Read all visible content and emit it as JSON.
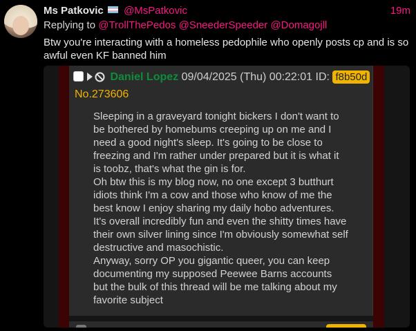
{
  "tweet": {
    "display_name": "Ms Patkovic",
    "flag_icon": "transgender-flag-icon",
    "handle": "@MsPatkovic",
    "time": "19m",
    "replying_prefix": "Replying to",
    "mentions": [
      "@TrollThePedos",
      "@SneederSpeeder",
      "@Domagojll"
    ],
    "text": "Btw you're interacting with a homeless pedophile who openly posts cp and is so awful even KF banned him"
  },
  "screenshot": {
    "poster_name": "Daniel Lopez",
    "datetime": "09/04/2025 (Thu) 00:22:01",
    "id_label": "ID:",
    "id_value": "f8b50d",
    "post_number": "No.273606",
    "body_lines": [
      "Sleeping in a graveyard tonight bickers I don't want to",
      "be bothered by homebums creeping up on me and I",
      "need a good night's sleep. It's going to be close to",
      "freezing and I'm rather under prepared but it is what it",
      "is toobz, that's what the gin is for.",
      "Oh btw this is my blog now, no one except 3 butthurt",
      "idiots think I'm a cow and those who know of me the",
      "best know I enjoy sharing my daily hobo adventures.",
      "It's overall incredibly fun and even the shitty times have",
      "their own silver lining since I'm obviously somewhat self",
      "destructive and masochistic.",
      "Anyway, sorry OP you gigantic queer, you can keep",
      "documenting my supposed Peewee Barns accounts",
      "but the bulk of this thread will be me talking about my",
      "favorite subject"
    ],
    "colors": {
      "poster_name": "#0f8c3a",
      "id_badge": "#f0b400",
      "side_bars": "#3b0303"
    }
  }
}
